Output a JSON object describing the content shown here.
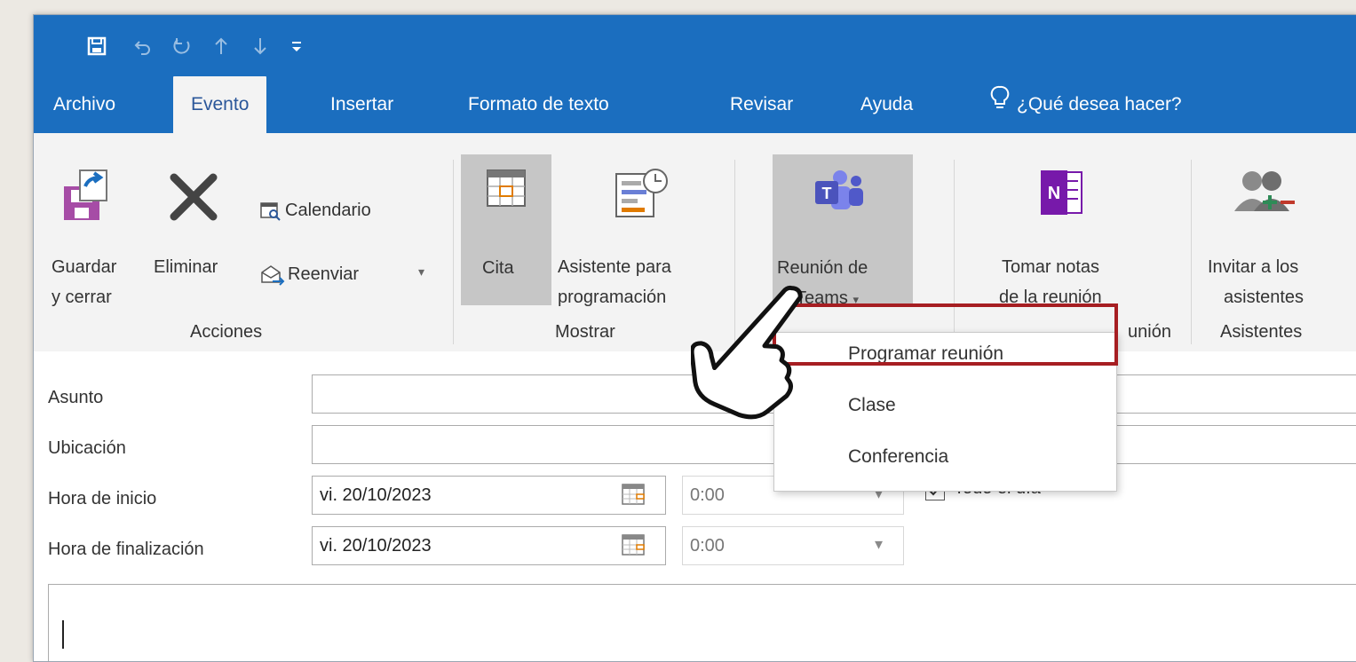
{
  "quick_access": [
    {
      "name": "save-icon",
      "glyph": "□"
    },
    {
      "name": "undo-icon",
      "glyph": "↶"
    },
    {
      "name": "redo-icon",
      "glyph": "↻"
    },
    {
      "name": "up-arrow-icon",
      "glyph": "↑"
    },
    {
      "name": "down-arrow-icon",
      "glyph": "↓"
    },
    {
      "name": "customize-icon",
      "glyph": "≡"
    }
  ],
  "tabs": {
    "archivo": "Archivo",
    "evento": "Evento",
    "insertar": "Insertar",
    "formato": "Formato de texto",
    "revisar": "Revisar",
    "ayuda": "Ayuda",
    "tell_me": "¿Qué desea hacer?"
  },
  "ribbon": {
    "guardar_1": "Guardar",
    "guardar_2": "y cerrar",
    "eliminar": "Eliminar",
    "calendario": "Calendario",
    "reenviar": "Reenviar",
    "acciones": "Acciones",
    "cita": "Cita",
    "asistente_1": "Asistente para",
    "asistente_2": "programación",
    "mostrar": "Mostrar",
    "teams_1": "Reunión de",
    "teams_2": "Teams",
    "onenote_1": "Tomar notas",
    "onenote_2": "de la reunión",
    "reunion_group": "unión",
    "invitar_1": "Invitar a los",
    "invitar_2": "asistentes",
    "asistentes": "Asistentes"
  },
  "form": {
    "asunto": "Asunto",
    "ubicacion": "Ubicación",
    "inicio": "Hora de inicio",
    "fin": "Hora de finalización",
    "start_date": "vi. 20/10/2023",
    "start_time": "0:00",
    "end_date": "vi. 20/10/2023",
    "end_time": "0:00",
    "all_day": "Todo el día",
    "all_day_checked": true
  },
  "dropdown": {
    "items": [
      "Programar reunión",
      "Clase",
      "Conferencia"
    ],
    "highlighted": "Programar reunión"
  },
  "colors": {
    "accent": "#1b6ebf",
    "highlight_border": "#a61e22",
    "teams_purple": "#5059c9",
    "onenote_purple": "#7719aa"
  }
}
